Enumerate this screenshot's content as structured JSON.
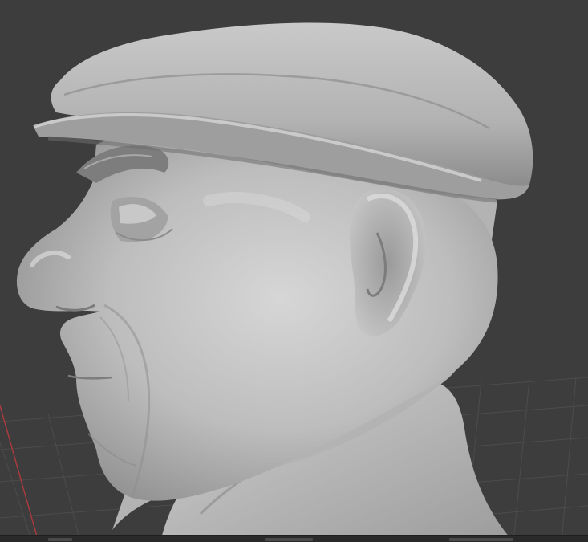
{
  "viewport": {
    "background_color": "#3d3d3d",
    "grid_color": "#4c4c4c",
    "x_axis_color": "#a63a3f",
    "model_base_color": "#b7b7b7",
    "model_shadow_color": "#6e6e6e",
    "model_highlight_color": "#dcdcdc",
    "subject": "sculpted-bust-flat-cap"
  }
}
